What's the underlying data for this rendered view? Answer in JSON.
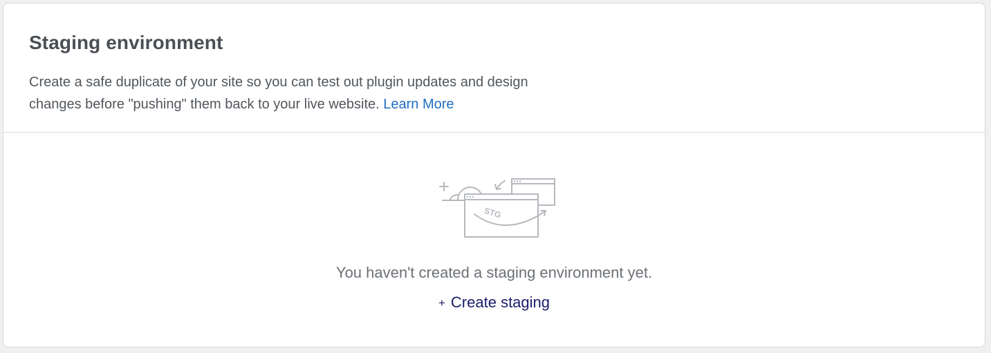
{
  "card": {
    "title": "Staging environment",
    "description": "Create a safe duplicate of your site so you can test out plugin updates and design changes before \"pushing\" them back to your live website.",
    "learn_more_label": "Learn More"
  },
  "empty_state": {
    "illustration_icon": "staging-illustration-icon",
    "illustration_text": "STG",
    "message": "You haven't created a staging environment yet.",
    "create_symbol": "+",
    "create_label": "Create staging"
  },
  "colors": {
    "title": "#4a4f55",
    "link": "#1f6fc1",
    "create_link": "#1b1d6a",
    "muted_text": "#6c7177",
    "illustration_stroke": "#b5b8bd"
  }
}
